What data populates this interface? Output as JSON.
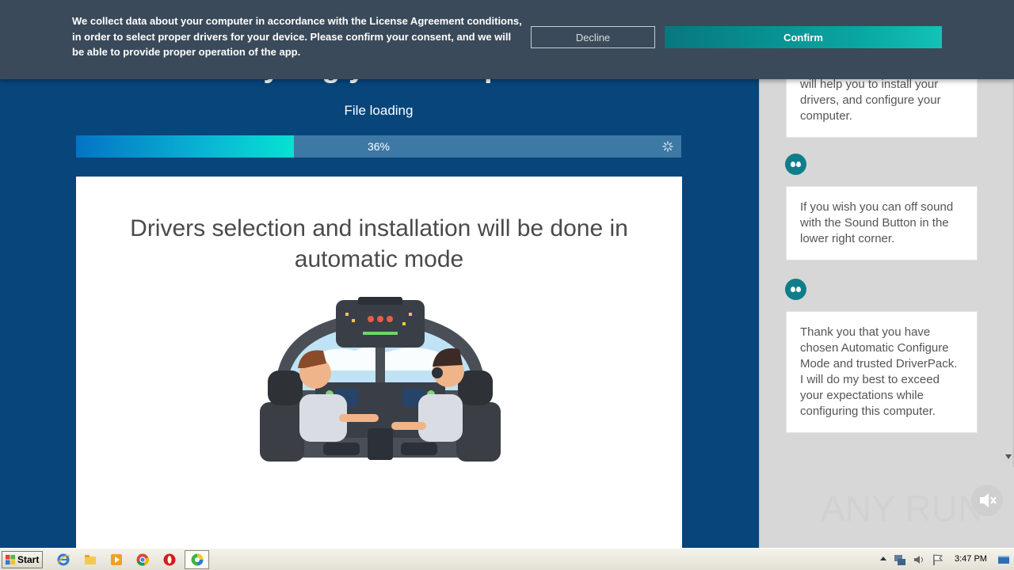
{
  "app": {
    "headline": "Analyzing your computer",
    "file_loading_label": "File loading",
    "progress_percent": 36,
    "progress_text": "36%",
    "card_title": "Drivers selection and installation will be done in automatic mode"
  },
  "chat": {
    "messages": [
      "will help you to install your drivers, and configure your computer.",
      "If you wish you can off sound with the Sound Button in the lower right corner.",
      "Thank you that you have chosen Automatic Configure Mode and trusted DriverPack. I will do my best to exceed your expectations while configuring this computer."
    ]
  },
  "consent": {
    "text": "We collect data about your computer in accordance with the License Agreement conditions, in order to select proper drivers for your device. Please confirm your consent, and we will be able to provide proper operation of the app.",
    "decline_label": "Decline",
    "confirm_label": "Confirm"
  },
  "watermark": {
    "text": "ANY RUN"
  },
  "taskbar": {
    "start_label": "Start",
    "clock": "3:47 PM",
    "pinned_icons": [
      "internet-explorer-icon",
      "folder-icon",
      "media-player-icon",
      "chrome-icon",
      "opera-icon"
    ],
    "tray_icons": [
      "show-hidden-icons-icon",
      "network-icon",
      "volume-icon",
      "flag-icon"
    ]
  },
  "colors": {
    "app_background": "#07457a",
    "banner_background": "#3b4a5a",
    "confirm_button": "#0aa6a2",
    "progress_fill": "#06e2d2",
    "bot_avatar": "#0e7e8a"
  }
}
